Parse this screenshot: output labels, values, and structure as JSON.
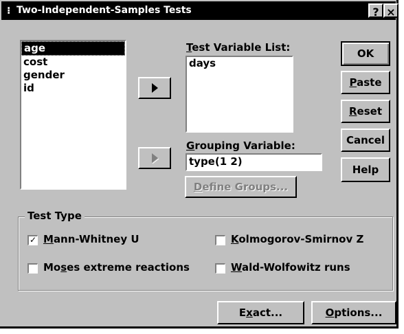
{
  "window": {
    "title": "Two-Independent-Samples Tests",
    "help_button": "?",
    "close_button": "×"
  },
  "source_list": {
    "items": [
      {
        "label": "age",
        "selected": true
      },
      {
        "label": "cost",
        "selected": false
      },
      {
        "label": "gender",
        "selected": false
      },
      {
        "label": "id",
        "selected": false
      }
    ]
  },
  "test_variable": {
    "label": "Test Variable List:",
    "items": [
      "days"
    ]
  },
  "grouping": {
    "label": "Grouping Variable:",
    "value": "type(1 2)",
    "define_groups": "Define Groups..."
  },
  "buttons": {
    "ok": "OK",
    "paste": "Paste",
    "reset": "Reset",
    "cancel": "Cancel",
    "help": "Help",
    "exact": "Exact...",
    "options": "Options..."
  },
  "test_type": {
    "title": "Test Type",
    "options": [
      {
        "label": "Mann-Whitney U",
        "checked": true
      },
      {
        "label": "Kolmogorov-Smirnov Z",
        "checked": false
      },
      {
        "label": "Moses extreme reactions",
        "checked": false
      },
      {
        "label": "Wald-Wolfowitz runs",
        "checked": false
      }
    ]
  }
}
